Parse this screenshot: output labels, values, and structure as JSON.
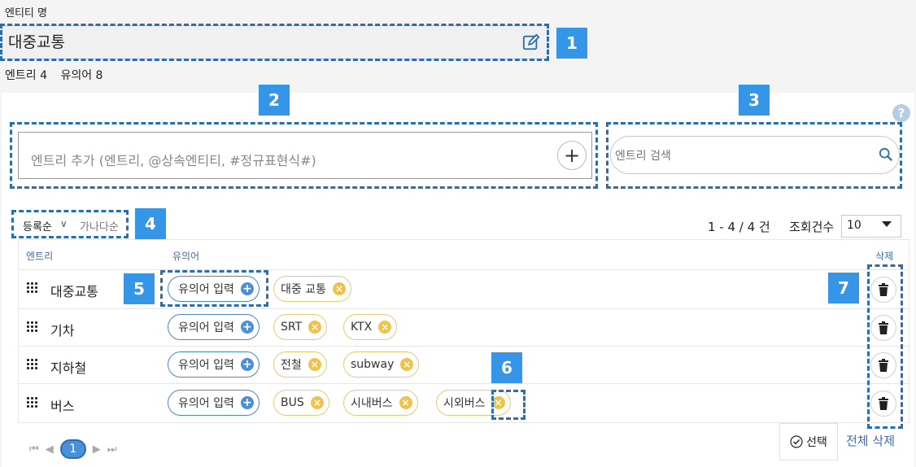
{
  "entity": {
    "label": "엔티티 명",
    "name": "대중교통",
    "counts": {
      "entry": "엔트리 4",
      "synonym": "유의어 8"
    }
  },
  "add_entry": {
    "placeholder": "엔트리 추가 (엔트리, @상속엔티티, #정규표현식#)",
    "button": "+"
  },
  "search": {
    "placeholder": "엔트리 검색"
  },
  "help": "?",
  "sort": {
    "primary": "등록순",
    "chevron": "∨",
    "secondary": "가나다순"
  },
  "paging": {
    "info": "1 - 4 / 4 건",
    "size_label": "조회건수",
    "size_value": "10"
  },
  "table": {
    "headers": {
      "entry": "엔트리",
      "synonym": "유의어",
      "delete": "삭제"
    },
    "synonym_input_label": "유의어 입력",
    "rows": [
      {
        "name": "대중교통",
        "synonyms": [
          "대중 교통"
        ]
      },
      {
        "name": "기차",
        "synonyms": [
          "SRT",
          "KTX"
        ]
      },
      {
        "name": "지하철",
        "synonyms": [
          "전철",
          "subway"
        ]
      },
      {
        "name": "버스",
        "synonyms": [
          "BUS",
          "시내버스",
          "시외버스"
        ]
      }
    ]
  },
  "pager": {
    "first": "⏮",
    "prev": "◀",
    "current": "1",
    "next": "▶",
    "last": "⏭"
  },
  "footer": {
    "select": "선택",
    "delete_all": "전체 삭제"
  },
  "annotations": [
    "1",
    "2",
    "3",
    "4",
    "5",
    "6",
    "7"
  ],
  "colors": {
    "accent": "#3595e6",
    "dash": "#2a6db0",
    "synonym_border": "#e8c878",
    "link": "#3b6db4"
  }
}
